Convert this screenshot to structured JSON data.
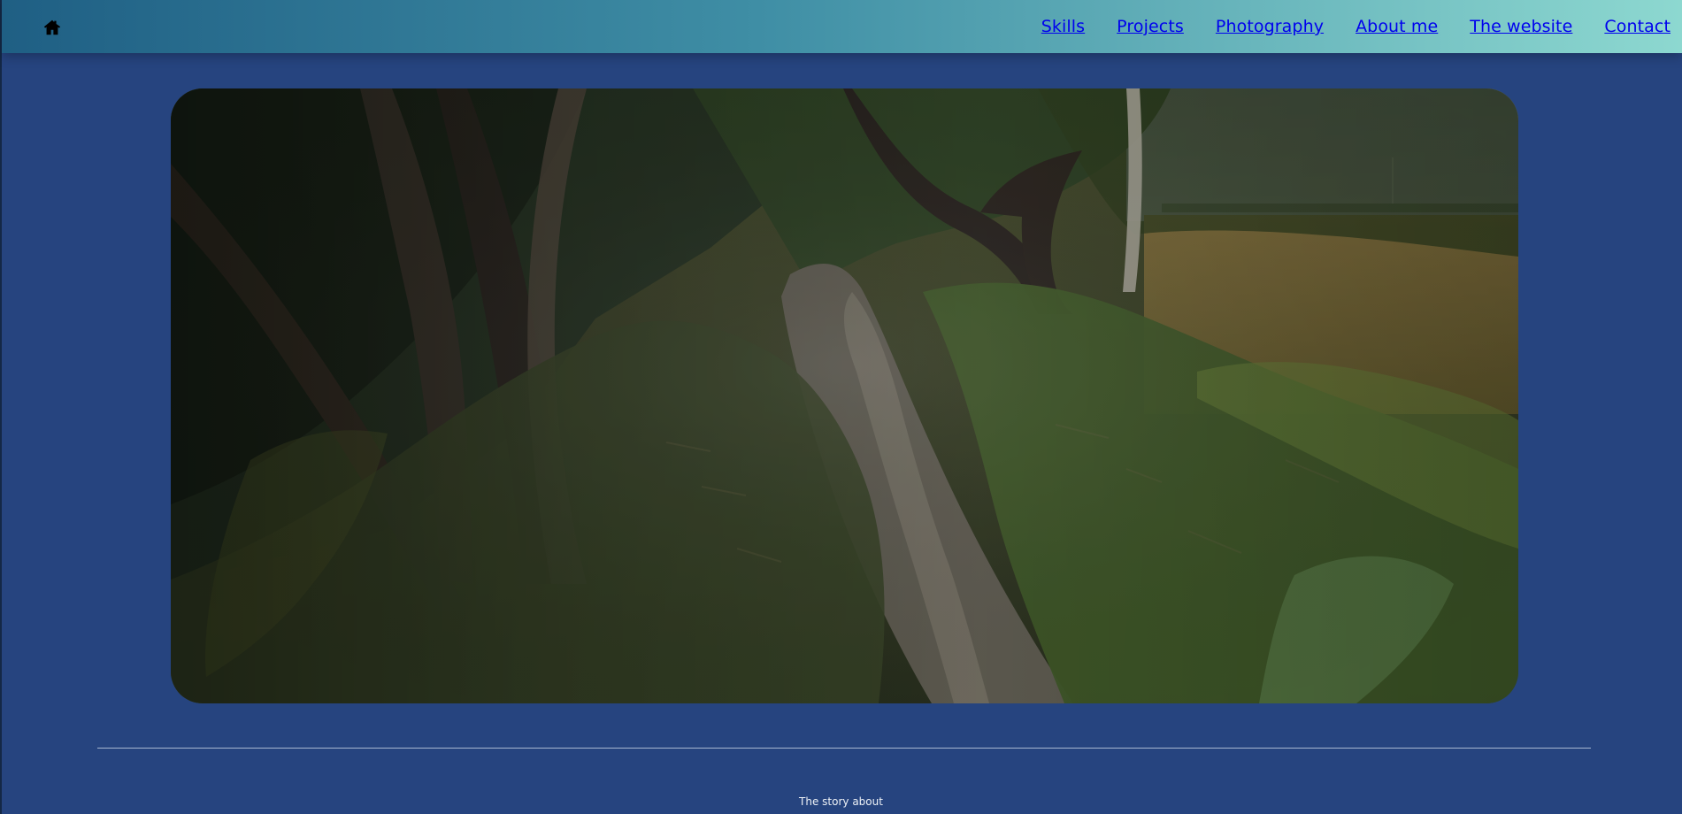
{
  "nav": {
    "items": [
      {
        "label": "Skills"
      },
      {
        "label": "Projects"
      },
      {
        "label": "Photography"
      },
      {
        "label": "About me"
      },
      {
        "label": "The website"
      },
      {
        "label": "Contact"
      }
    ]
  },
  "icons": {
    "home": "home-icon"
  },
  "content": {
    "story_label": "The story about"
  },
  "colors": {
    "page_background": "#26447f",
    "nav_start": "#1f5f84",
    "nav_end": "#8dd8d0"
  }
}
